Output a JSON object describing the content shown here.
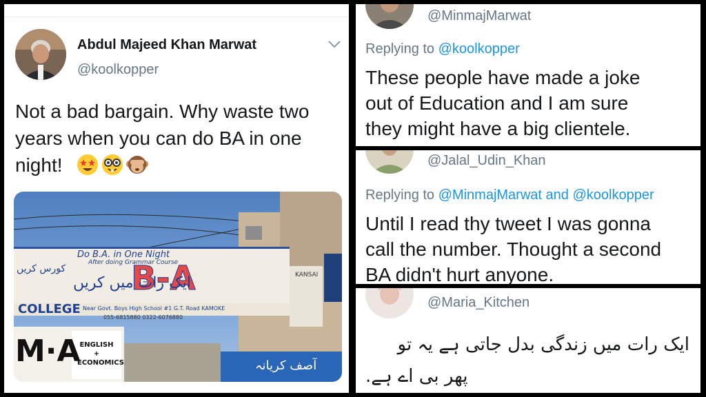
{
  "main_tweet": {
    "author_name": "Abdul Majeed Khan Marwat",
    "author_handle": "@koolkopper",
    "text": "Not a bad bargain. Why waste two\nyears when you can do BA in one\nnight!",
    "emojis": [
      "star-struck-emoji",
      "nerd-face-emoji",
      "see-no-evil-monkey-emoji"
    ],
    "photo": {
      "banner_line1": "Do B.A. in One Night",
      "banner_line2": "After doing Grammar Course",
      "banner_urdu": "ایک رات میں کریں",
      "banner_big": "B-A",
      "banner_left": "کورس کریں",
      "college_label": "COLLEGE",
      "college_address": "Near Govt. Boys High School #1 G.T. Road KAMOKE",
      "phones": "055-6815880   0322-6076880",
      "shop_sign": "KANSAI",
      "left_sign": "M·A",
      "left_sign_small": "ENGLISH\n+\nECONOMICS",
      "bottom_urdu": "آصف کریانہ"
    }
  },
  "replies": [
    {
      "handle": "@MinmajMarwat",
      "replying_label": "Replying to",
      "replying_to": "@koolkopper",
      "replying_and": "",
      "replying_to_2": "",
      "text": "These people have made a joke\nout of Education and I am sure\nthey might have a big clientele."
    },
    {
      "handle": "@Jalal_Udin_Khan",
      "replying_label": "Replying to",
      "replying_to": "@MinmajMarwat",
      "replying_and": "and",
      "replying_to_2": "@koolkopper",
      "text": "Until I read thy tweet I was gonna\ncall the number. Thought a second\nBA didn't hurt anyone."
    },
    {
      "handle": "@Maria_Kitchen",
      "text_line1": "ایک رات میں زندگی بدل جاتی ہے یہ تو",
      "text_line2": "پھر بی اے ہے."
    }
  ],
  "colors": {
    "link": "#1b95e0",
    "secondary": "#657786",
    "text": "#14171a",
    "border": "#000000"
  }
}
